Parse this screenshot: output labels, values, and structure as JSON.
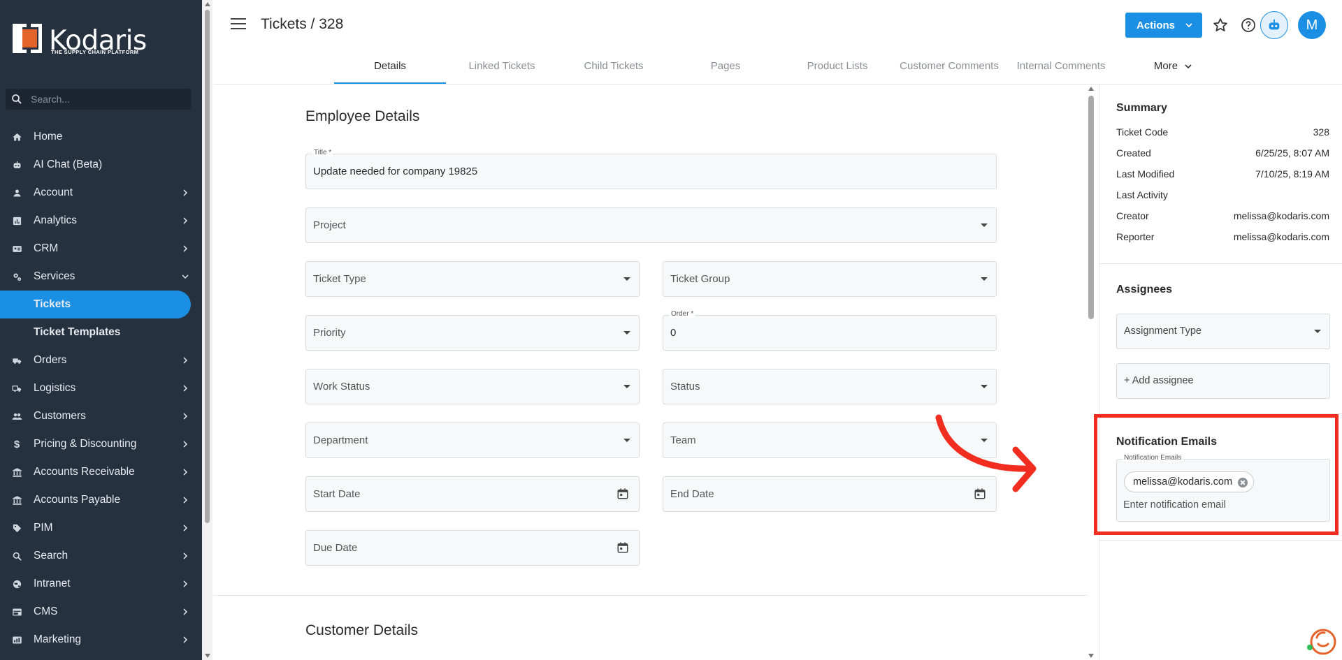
{
  "app": {
    "logo_text": "Kodaris",
    "logo_tagline": "THE SUPPLY CHAIN PLATFORM",
    "brand_color": "#1a8fe3",
    "sidebar_color": "#263140",
    "highlight_color": "#f02d1e"
  },
  "sidebar": {
    "search_placeholder": "Search...",
    "items": [
      {
        "label": "Home",
        "icon": "home-icon"
      },
      {
        "label": "AI Chat (Beta)",
        "icon": "robot-icon"
      },
      {
        "label": "Account",
        "icon": "person-icon",
        "expandable": true
      },
      {
        "label": "Analytics",
        "icon": "analytics-icon",
        "expandable": true
      },
      {
        "label": "CRM",
        "icon": "contact-card-icon",
        "expandable": true
      },
      {
        "label": "Services",
        "icon": "services-gear-icon",
        "expanded": true
      },
      {
        "label": "Tickets",
        "sub": true,
        "active": true
      },
      {
        "label": "Ticket Templates",
        "sub": true
      },
      {
        "label": "Orders",
        "icon": "truck-icon",
        "expandable": true
      },
      {
        "label": "Logistics",
        "icon": "delivery-icon",
        "expandable": true
      },
      {
        "label": "Customers",
        "icon": "group-icon",
        "expandable": true
      },
      {
        "label": "Pricing & Discounting",
        "icon": "dollar-icon",
        "expandable": true
      },
      {
        "label": "Accounts Receivable",
        "icon": "bank-icon",
        "expandable": true
      },
      {
        "label": "Accounts Payable",
        "icon": "bank-icon",
        "expandable": true
      },
      {
        "label": "PIM",
        "icon": "tag-icon",
        "expandable": true
      },
      {
        "label": "Search",
        "icon": "search-icon",
        "expandable": true
      },
      {
        "label": "Intranet",
        "icon": "globe-icon",
        "expandable": true
      },
      {
        "label": "CMS",
        "icon": "web-icon",
        "expandable": true
      },
      {
        "label": "Marketing",
        "icon": "megaphone-icon",
        "expandable": true
      }
    ]
  },
  "header": {
    "title": "Tickets / 328",
    "actions_label": "Actions",
    "avatar_initial": "M"
  },
  "tabs": [
    {
      "label": "Details",
      "active": true
    },
    {
      "label": "Linked Tickets"
    },
    {
      "label": "Child Tickets"
    },
    {
      "label": "Pages"
    },
    {
      "label": "Product Lists"
    },
    {
      "label": "Customer Comments"
    },
    {
      "label": "Internal Comments"
    },
    {
      "label": "More"
    }
  ],
  "employee_details": {
    "section_title": "Employee Details",
    "title_label": "Title *",
    "title_value": "Update needed for company 19825",
    "project_placeholder": "Project",
    "ticket_type_placeholder": "Ticket Type",
    "ticket_group_placeholder": "Ticket Group",
    "priority_placeholder": "Priority",
    "order_label": "Order *",
    "order_value": "0",
    "work_status_placeholder": "Work Status",
    "status_placeholder": "Status",
    "department_placeholder": "Department",
    "team_placeholder": "Team",
    "start_date_placeholder": "Start Date",
    "end_date_placeholder": "End Date",
    "due_date_placeholder": "Due Date"
  },
  "customer_details": {
    "section_title": "Customer Details"
  },
  "summary": {
    "title": "Summary",
    "rows": [
      {
        "key": "Ticket Code",
        "value": "328"
      },
      {
        "key": "Created",
        "value": "6/25/25, 8:07 AM"
      },
      {
        "key": "Last Modified",
        "value": "7/10/25, 8:19 AM"
      },
      {
        "key": "Last Activity",
        "value": ""
      },
      {
        "key": "Creator",
        "value": "melissa@kodaris.com"
      },
      {
        "key": "Reporter",
        "value": "melissa@kodaris.com"
      }
    ]
  },
  "assignees": {
    "title": "Assignees",
    "assignment_type_placeholder": "Assignment Type",
    "add_assignee_label": "+ Add assignee"
  },
  "notification_emails": {
    "title": "Notification Emails",
    "field_label": "Notification Emails",
    "chips": [
      "melissa@kodaris.com"
    ],
    "input_placeholder": "Enter notification email"
  }
}
